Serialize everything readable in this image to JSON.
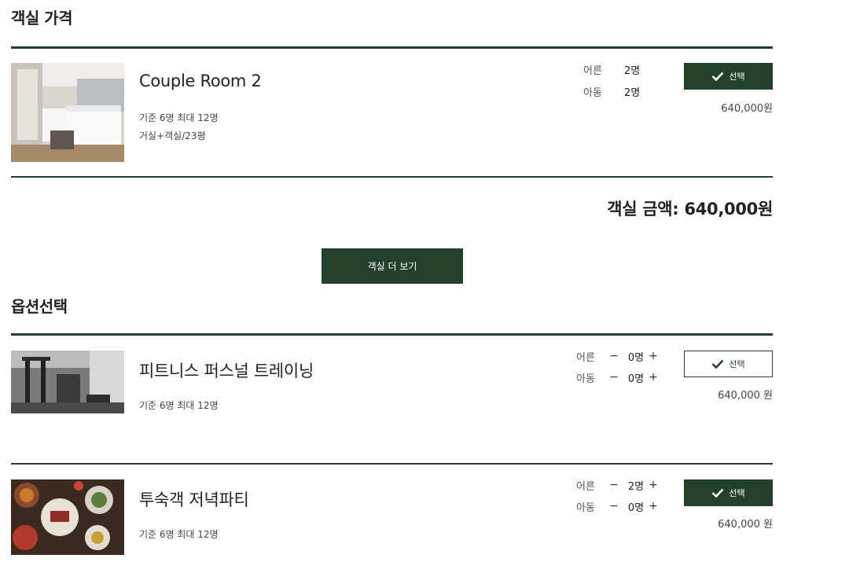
{
  "room_section": {
    "title": "객실 가격",
    "room": {
      "name": "Couple Room 2",
      "capacity": "기준 6명 최대 12명",
      "layout": "거실+객실/23평",
      "guests": [
        {
          "label": "어른",
          "count": "2명"
        },
        {
          "label": "아동",
          "count": "2명"
        }
      ],
      "select_label": "선택",
      "price": "640,000원"
    },
    "total_label": "객실 금액: 640,000원",
    "more_button": "객실 더 보기"
  },
  "option_section": {
    "title": "옵션선택",
    "options": [
      {
        "name": "피트니스 퍼스널 트레이닝",
        "capacity": "기준 6명 최대 12명",
        "guests": [
          {
            "label": "어른",
            "count": "0명"
          },
          {
            "label": "아동",
            "count": "0명"
          }
        ],
        "minus": "−",
        "plus": "+",
        "select_label": "선택",
        "selected": false,
        "price": "640,000 원"
      },
      {
        "name": "투숙객 저녁파티",
        "capacity": "기준 6명 최대 12명",
        "guests": [
          {
            "label": "어른",
            "count": "2명"
          },
          {
            "label": "아동",
            "count": "0명"
          }
        ],
        "minus": "−",
        "plus": "+",
        "select_label": "선택",
        "selected": true,
        "price": "640,000 원"
      }
    ]
  },
  "colors": {
    "accent": "#23402a",
    "text": "#222222"
  }
}
